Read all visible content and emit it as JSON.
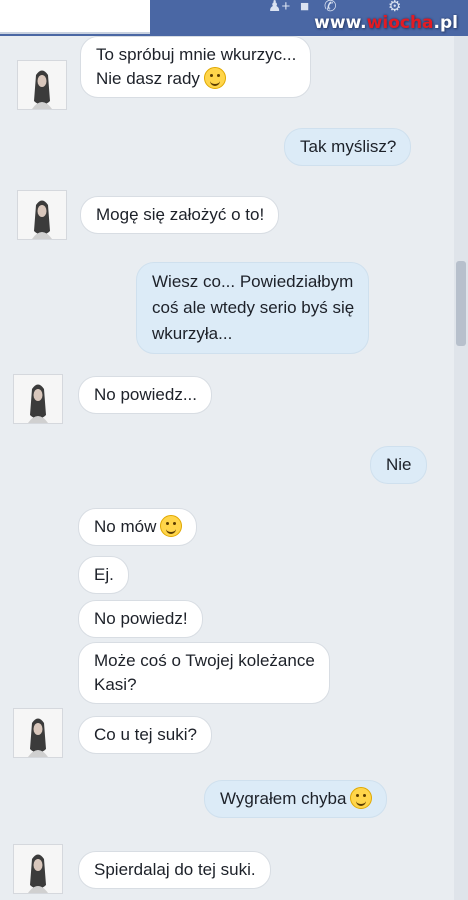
{
  "watermark": {
    "prefix": "www.",
    "name": "wiocha",
    "suffix": ".pl"
  },
  "header_icons": {
    "add_user": "add-user-icon",
    "video": "video-icon",
    "phone": "phone-icon",
    "settings": "gear-icon"
  },
  "messages": [
    {
      "side": "in",
      "lines": [
        "To spróbuj mnie wkurzyc...",
        "Nie dasz rady"
      ],
      "emoji": "grinning-emoji"
    },
    {
      "side": "out",
      "lines": [
        "Tak myślisz?"
      ]
    },
    {
      "side": "in",
      "lines": [
        "Mogę się założyć o to!"
      ]
    },
    {
      "side": "out",
      "lines": [
        "Wiesz co... Powiedziałbym",
        "coś ale wtedy serio byś się",
        "wkurzyła..."
      ]
    },
    {
      "side": "in",
      "lines": [
        "No powiedz..."
      ]
    },
    {
      "side": "out",
      "lines": [
        "Nie"
      ]
    },
    {
      "side": "in",
      "lines": [
        "No mów"
      ],
      "emoji": "smile-emoji"
    },
    {
      "side": "in",
      "lines": [
        "Ej."
      ]
    },
    {
      "side": "in",
      "lines": [
        "No powiedz!"
      ]
    },
    {
      "side": "in",
      "lines": [
        "Może coś o Twojej koleżance",
        "Kasi?"
      ]
    },
    {
      "side": "in",
      "lines": [
        "Co u tej suki?"
      ]
    },
    {
      "side": "out",
      "lines": [
        "Wygrałem chyba"
      ],
      "emoji": "grinning-emoji"
    },
    {
      "side": "in",
      "lines": [
        "Spierdalaj do tej suki."
      ]
    }
  ]
}
